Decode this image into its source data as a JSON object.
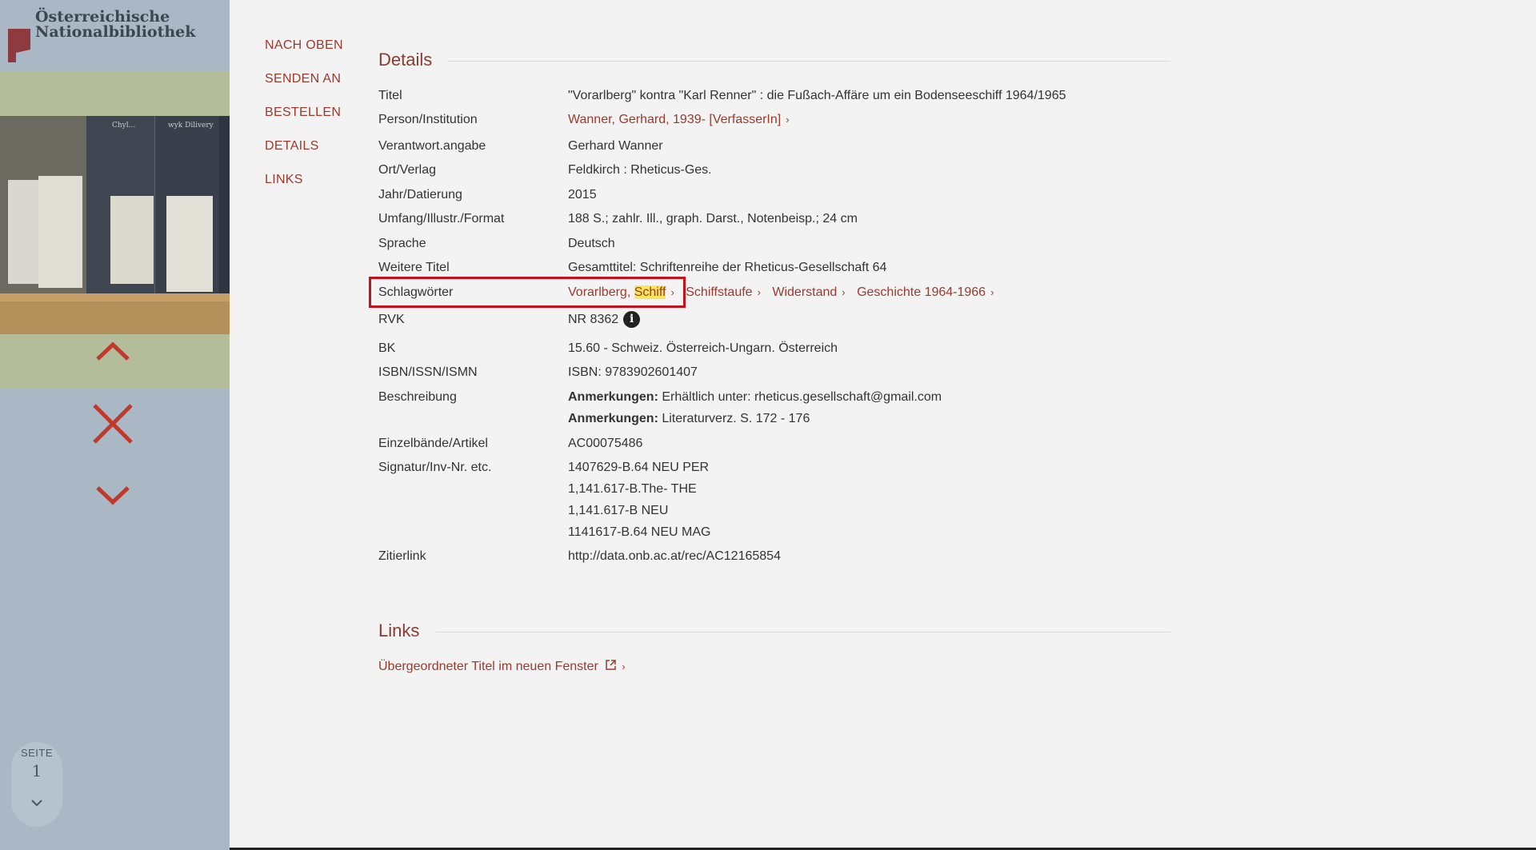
{
  "logo": {
    "line1": "Österreichische",
    "line2": "Nationalbibliothek"
  },
  "sidebar_controls": {
    "up": "chevron-up",
    "close": "close",
    "down": "chevron-down"
  },
  "pager": {
    "label": "SEITE",
    "page": "1"
  },
  "jumpnav": [
    "NACH OBEN",
    "SENDEN AN",
    "BESTELLEN",
    "DETAILS",
    "LINKS"
  ],
  "details": {
    "heading": "Details",
    "titel_label": "Titel",
    "titel_value": "\"Vorarlberg\" kontra \"Karl Renner\" : die Fußach-Affäre um ein Bodenseeschiff 1964/1965",
    "person_label": "Person/Institution",
    "person_value": "Wanner, Gerhard, 1939- [VerfasserIn]",
    "verantwort_label": "Verantwort.angabe",
    "verantwort_value": "Gerhard Wanner",
    "ort_label": "Ort/Verlag",
    "ort_value": "Feldkirch : Rheticus-Ges.",
    "jahr_label": "Jahr/Datierung",
    "jahr_value": "2015",
    "umfang_label": "Umfang/Illustr./Format",
    "umfang_value": "188 S.; zahlr. Ill., graph. Darst., Notenbeisp.; 24 cm",
    "sprache_label": "Sprache",
    "sprache_value": "Deutsch",
    "weitere_label": "Weitere Titel",
    "weitere_value": "Gesamttitel: Schriftenreihe der Rheticus-Gesellschaft 64",
    "schlag_label": "Schlagwörter",
    "schlag_1a": "Vorarlberg, ",
    "schlag_1b": "Schiff",
    "schlag_2": "Schiffstaufe",
    "schlag_3": "Widerstand",
    "schlag_4": "Geschichte 1964-1966",
    "rvk_label": "RVK",
    "rvk_value": "NR 8362",
    "bk_label": "BK",
    "bk_value": "15.60 - Schweiz. Österreich-Ungarn. Österreich",
    "isbn_label": "ISBN/ISSN/ISMN",
    "isbn_value": "ISBN: 9783902601407",
    "beschr_label": "Beschreibung",
    "anm_label": "Anmerkungen:",
    "anm1_value": " Erhältlich unter: rheticus.gesellschaft@gmail.com",
    "anm2_value": " Literaturverz. S. 172 - 176",
    "einzel_label": "Einzelbände/Artikel",
    "einzel_value": "AC00075486",
    "sig_label": "Signatur/Inv-Nr. etc.",
    "sig1": "1407629-B.64 NEU PER",
    "sig2": "1,141.617-B.The- THE",
    "sig3": "1,141.617-B NEU",
    "sig4": "1141617-B.64 NEU MAG",
    "zitier_label": "Zitierlink",
    "zitier_value": "http://data.onb.ac.at/rec/AC12165854"
  },
  "links": {
    "heading": "Links",
    "parent_title": "Übergeordneter Titel im neuen Fenster"
  },
  "colors": {
    "accent": "#9a3a2c",
    "highlight": "#ffe55c",
    "box": "#c4111b",
    "sidebar": "#a9b8c4",
    "sidebar_green": "#b3bd9a"
  }
}
